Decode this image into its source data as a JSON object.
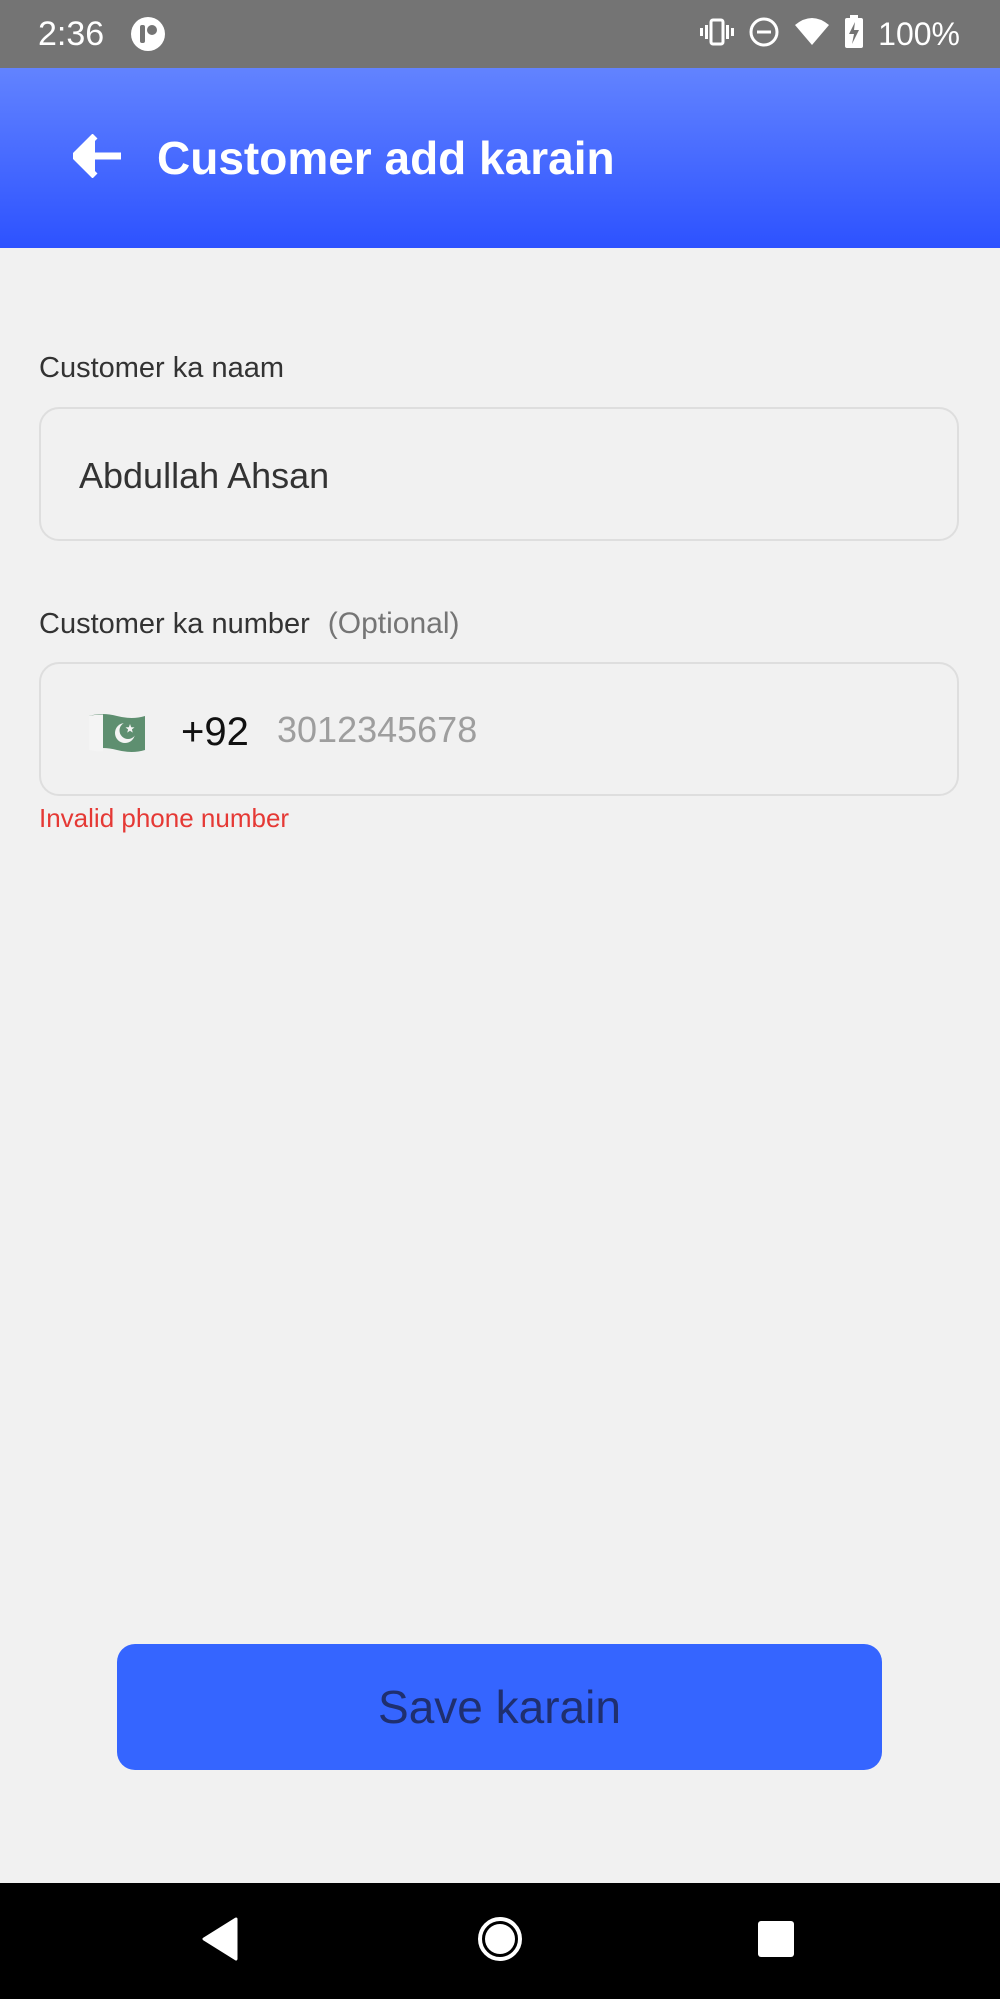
{
  "status_bar": {
    "time": "2:36",
    "battery": "100%",
    "icons": [
      "app-notification-icon",
      "vibrate-icon",
      "do-not-disturb-icon",
      "wifi-icon",
      "battery-charging-icon"
    ]
  },
  "app_bar": {
    "title": "Customer add karain",
    "back_icon": "arrow-left-icon",
    "gradient_top": "#6283ff",
    "gradient_bottom": "#2d52ff"
  },
  "form": {
    "name_field": {
      "label": "Customer ka naam",
      "value": "Abdullah Ahsan"
    },
    "number_field": {
      "label": "Customer ka number",
      "optional": "(Optional)",
      "flag_icon": "pakistan-flag-icon",
      "country_code": "+92",
      "placeholder": "3012345678",
      "value": "",
      "error": "Invalid phone number"
    }
  },
  "save_button": {
    "label": "Save karain",
    "color": "#3565ff"
  },
  "nav_bar": {
    "icons": [
      "back-triangle-icon",
      "home-circle-icon",
      "recents-square-icon"
    ]
  },
  "colors": {
    "accent": "#3565ff",
    "error": "#e53935",
    "background": "#f1f1f1"
  }
}
